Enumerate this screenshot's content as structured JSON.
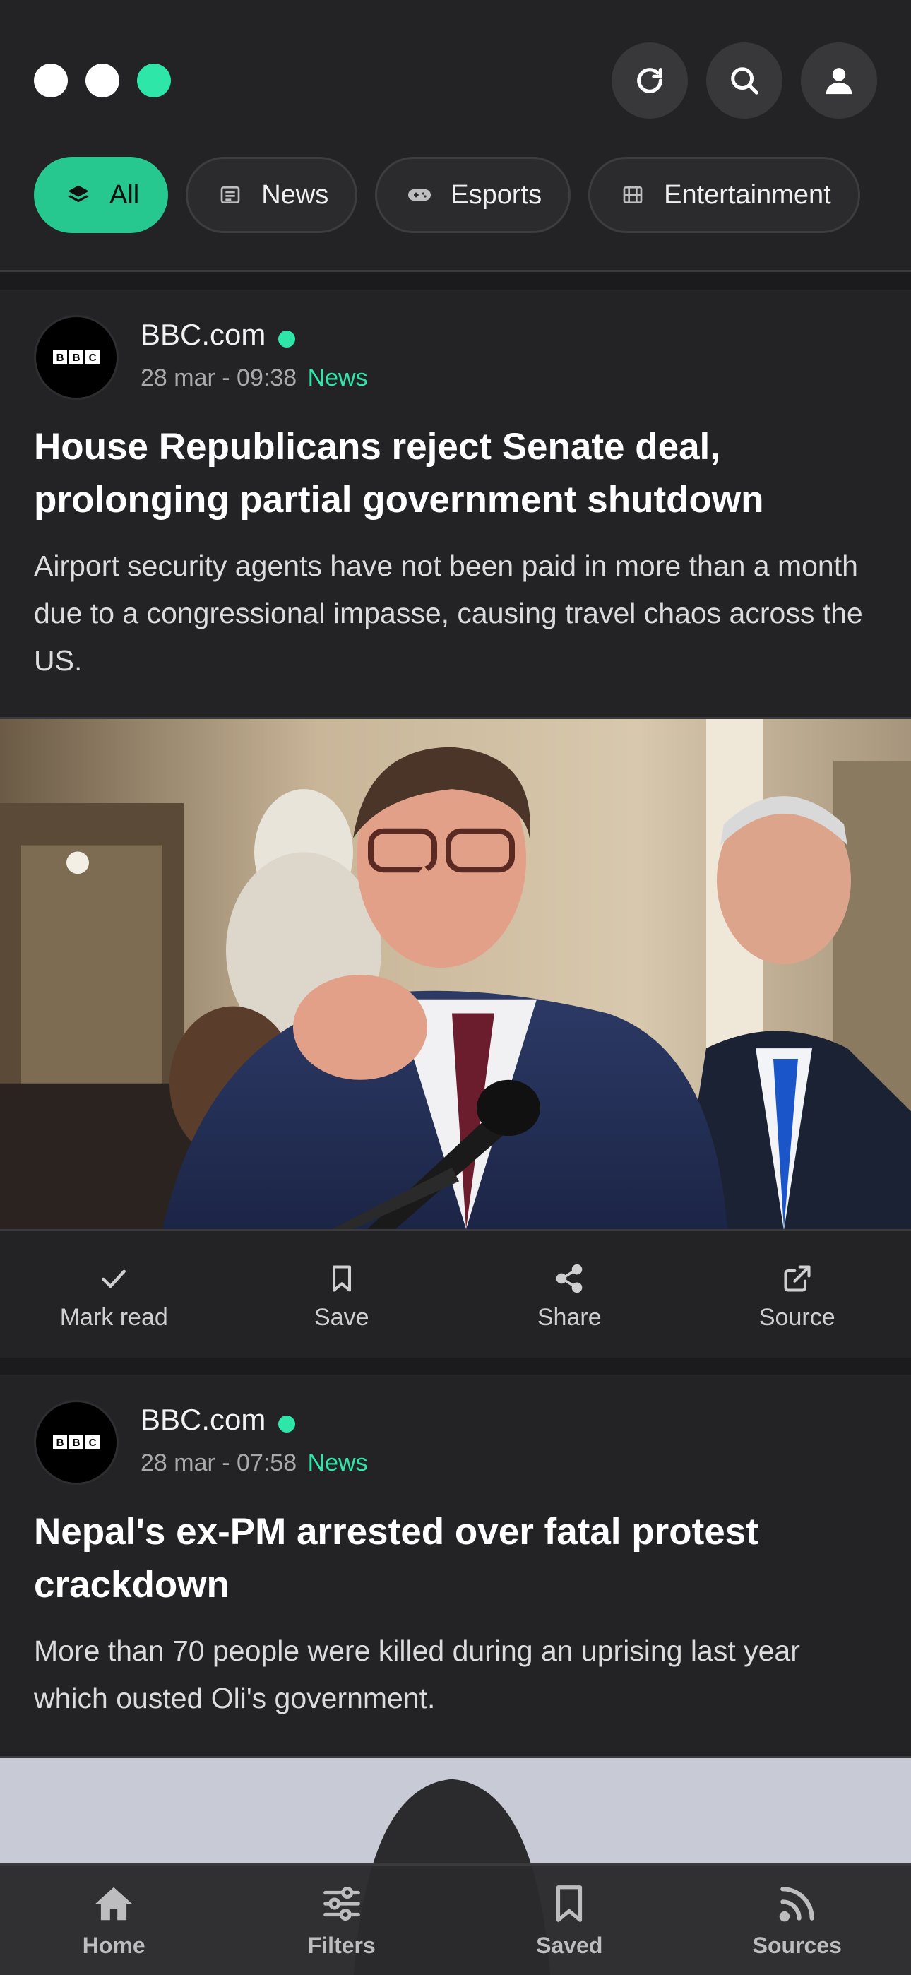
{
  "header": {
    "window_dots": [
      "white",
      "white",
      "green"
    ],
    "actions": [
      {
        "icon": "refresh-icon"
      },
      {
        "icon": "search-icon"
      },
      {
        "icon": "user-icon"
      }
    ]
  },
  "filters": [
    {
      "label": "All",
      "icon": "layers-icon",
      "active": true
    },
    {
      "label": "News",
      "icon": "newspaper-icon",
      "active": false
    },
    {
      "label": "Esports",
      "icon": "gamepad-icon",
      "active": false
    },
    {
      "label": "Entertainment",
      "icon": "film-icon",
      "active": false
    }
  ],
  "articles": [
    {
      "source": "BBC.com",
      "time": "28 mar - 09:38",
      "category": "News",
      "title": "House Republicans reject Senate deal, prolonging partial government shutdown",
      "summary": "Airport security agents have not been paid in more than a month due to a congressional impasse, causing travel chaos across the US.",
      "actions": {
        "mark_read": "Mark read",
        "save": "Save",
        "share": "Share",
        "source": "Source"
      }
    },
    {
      "source": "BBC.com",
      "time": "28 mar - 07:58",
      "category": "News",
      "title": "Nepal's ex-PM arrested over fatal protest crackdown",
      "summary": "More than 70 people were killed during an uprising last year which ousted Oli's government."
    }
  ],
  "bottom_nav": {
    "home": "Home",
    "filters": "Filters",
    "saved": "Saved",
    "sources": "Sources"
  },
  "colors": {
    "accent": "#2ee6a8",
    "chip_active": "#27c88f",
    "background": "#1b1b1d",
    "card": "#232325"
  }
}
